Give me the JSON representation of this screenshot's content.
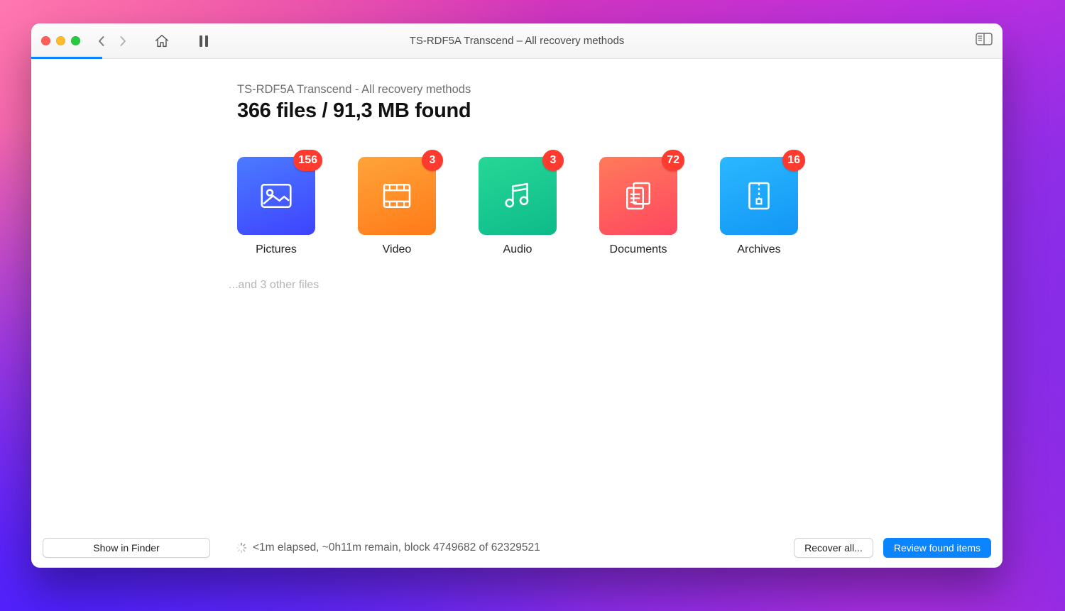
{
  "window": {
    "title": "TS-RDF5A Transcend – All recovery methods",
    "progress_fraction": 0.073
  },
  "header": {
    "breadcrumb": "TS-RDF5A Transcend - All recovery methods",
    "summary": "366 files / 91,3 MB found"
  },
  "categories": [
    {
      "key": "pictures",
      "label": "Pictures",
      "count": "156"
    },
    {
      "key": "video",
      "label": "Video",
      "count": "3"
    },
    {
      "key": "audio",
      "label": "Audio",
      "count": "3"
    },
    {
      "key": "documents",
      "label": "Documents",
      "count": "72"
    },
    {
      "key": "archives",
      "label": "Archives",
      "count": "16"
    }
  ],
  "other_files_note": "...and 3 other files",
  "footer": {
    "show_in_finder_label": "Show in Finder",
    "status_text": "<1m elapsed, ~0h11m remain, block 4749682 of 62329521",
    "recover_all_label": "Recover all...",
    "review_label": "Review found items"
  }
}
